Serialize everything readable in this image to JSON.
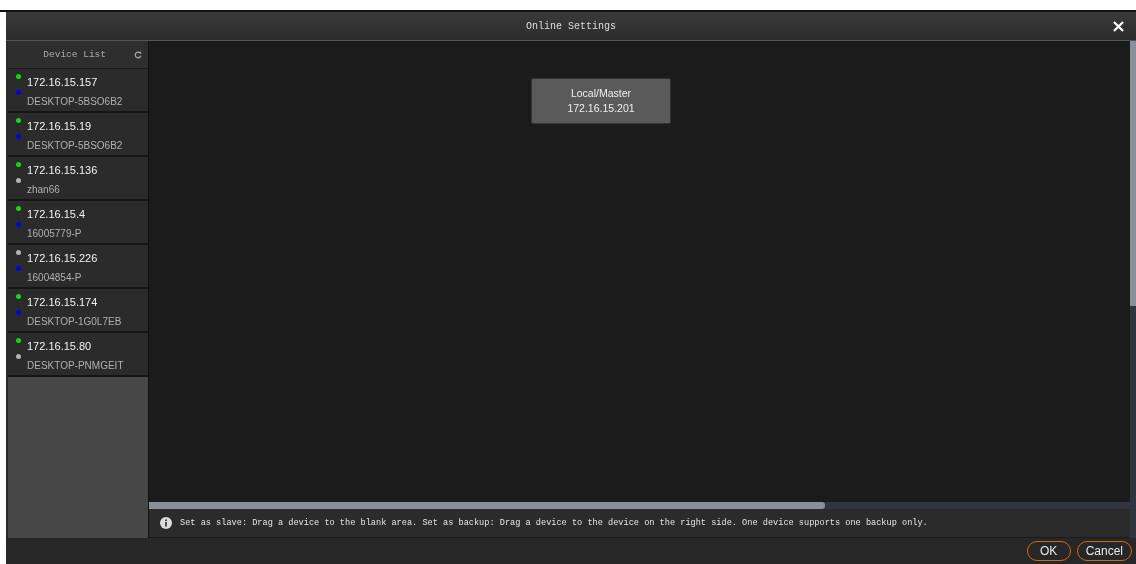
{
  "window": {
    "title": "Online Settings"
  },
  "device_list": {
    "title": "Device List",
    "items": [
      {
        "ip": "172.16.15.157",
        "ip_dot": {
          "color": "#00e600"
        },
        "name": "DESKTOP-5BSO6B2",
        "name_dot": {
          "color": "#0000ff"
        }
      },
      {
        "ip": "172.16.15.19",
        "ip_dot": {
          "color": "#00e600"
        },
        "name": "DESKTOP-5BSO6B2",
        "name_dot": {
          "color": "#0000ff"
        }
      },
      {
        "ip": "172.16.15.136",
        "ip_dot": {
          "color": "#00e600"
        },
        "name": "zhan66",
        "name_dot": {
          "color": "#b4b4b4"
        }
      },
      {
        "ip": "172.16.15.4",
        "ip_dot": {
          "color": "#00e600"
        },
        "name": "16005779-P",
        "name_dot": {
          "color": "#0000ff"
        }
      },
      {
        "ip": "172.16.15.226",
        "ip_dot": {
          "color": "#b4b4b4"
        },
        "name": "16004854-P",
        "name_dot": {
          "color": "#0000ff"
        }
      },
      {
        "ip": "172.16.15.174",
        "ip_dot": {
          "color": "#00e600"
        },
        "name": "DESKTOP-1G0L7EB",
        "name_dot": {
          "color": "#0000ff"
        }
      },
      {
        "ip": "172.16.15.80",
        "ip_dot": {
          "color": "#00e600"
        },
        "name": "DESKTOP-PNMGEIT",
        "name_dot": {
          "color": "#b4b4b4"
        }
      }
    ]
  },
  "canvas": {
    "nodes": [
      {
        "role": "Local/Master",
        "ip": "172.16.15.201"
      }
    ]
  },
  "info": "Set as slave: Drag a device to the blank area. Set as backup: Drag a device to the device on the right side. One device supports one backup only.",
  "buttons": [
    "OK",
    "Cancel"
  ]
}
